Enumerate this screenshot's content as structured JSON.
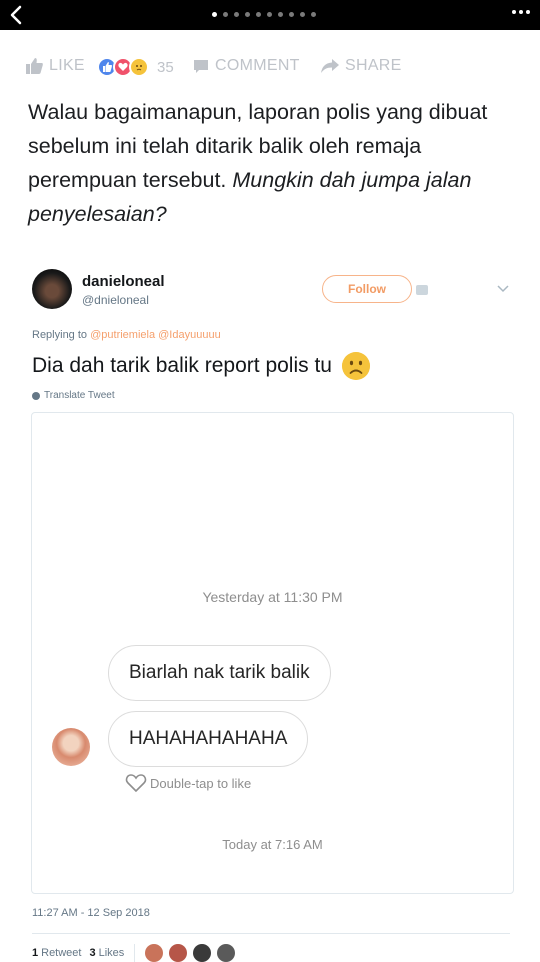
{
  "nav": {
    "page_dots": 10,
    "active_dot": 0
  },
  "actions": {
    "like_label": "LIKE",
    "reaction_count": "35",
    "comment_label": "COMMENT",
    "share_label": "SHARE"
  },
  "caption": {
    "normal": "Walau bagaimanapun, laporan polis yang dibuat sebelum ini telah ditarik balik oleh remaja perempuan tersebut. ",
    "italic": "Mungkin dah jumpa jalan penyelesaian?"
  },
  "tweet": {
    "username": "danieloneal",
    "handle": "@dnieloneal",
    "follow_label": "Follow",
    "replying_prefix": "Replying to",
    "replying_mentions": "@putriemiela @Idayuuuuu",
    "text": "Dia dah tarik balik report polis tu",
    "translate_label": "Translate Tweet",
    "timestamp": "11:27 AM - 12 Sep 2018",
    "retweets": "1",
    "retweet_label": "Retweet",
    "likes": "3",
    "likes_label": "Likes"
  },
  "screenshot_card": {
    "time_1": "Yesterday at 11:30 PM",
    "message_1": "Biarlah nak tarik balik",
    "message_2": "HAHAHAHAHAHA",
    "double_tap_label": "Double-tap to like",
    "time_2": "Today at 7:16 AM"
  },
  "colors": {
    "facebook_gray": "#bfc3c9",
    "twitter_orange": "#f29b64",
    "like_blue": "#4f86ec",
    "love_red": "#f0526b",
    "emoji_yellow": "#f5c33b"
  }
}
